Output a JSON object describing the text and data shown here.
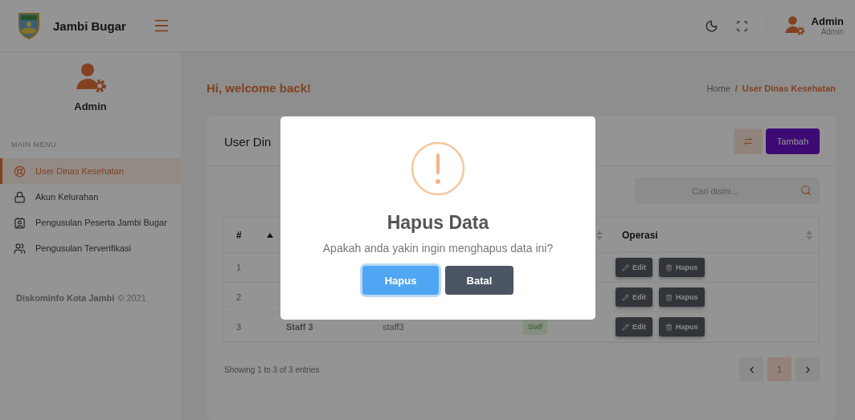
{
  "brand": {
    "name": "Jambi Bugar"
  },
  "topbar": {
    "user_name": "Admin",
    "user_role": "Admin"
  },
  "sidebar": {
    "profile_name": "Admin",
    "section_label": "MAIN MENU",
    "items": [
      {
        "label": "User Dinas Kesehatan",
        "kind": "lifebuoy",
        "selected": true
      },
      {
        "label": "Akun Kelurahan",
        "kind": "lock",
        "selected": false
      },
      {
        "label": "Pengusulan Peserta Jambi Bugar",
        "kind": "idcard",
        "selected": false
      },
      {
        "label": "Pengusulan Terverifikasi",
        "kind": "users",
        "selected": false
      }
    ],
    "footer_brand": "Diskominfo Kota Jambi",
    "footer_year": "© 2021"
  },
  "page": {
    "greeting": "Hi, welcome back!",
    "breadcrumb": [
      {
        "label": "Home",
        "selected": false
      },
      {
        "label": "User Dinas Kesehatan",
        "selected": true
      }
    ],
    "breadcrumb_separator": "/"
  },
  "card": {
    "title": "User Din",
    "add_button": "Tambah",
    "search": {
      "placeholder": "Cari disini..."
    },
    "columns": [
      {
        "label": "#",
        "sortable": true,
        "sorted": true
      },
      {},
      {},
      {
        "sortable": true,
        "sorted": false
      },
      {
        "label": "Operasi",
        "sortable": true,
        "sorted": false
      }
    ],
    "rows": [
      {
        "number": "1",
        "actions": [
          {
            "kind": "edit",
            "label": "Edit"
          },
          {
            "kind": "delete",
            "label": "Hapus"
          }
        ]
      },
      {
        "number": "2",
        "actions": [
          {
            "kind": "edit",
            "label": "Edit"
          },
          {
            "kind": "delete",
            "label": "Hapus"
          }
        ]
      },
      {
        "number": "3",
        "name": "Staff 3",
        "username": "staff3",
        "role": "Staff",
        "actions": [
          {
            "kind": "edit",
            "label": "Edit"
          },
          {
            "kind": "delete",
            "label": "Hapus"
          }
        ]
      }
    ],
    "info": "Showing 1 to 3 of 3 entries",
    "pages": [
      {
        "label": "1",
        "selected": true
      }
    ]
  },
  "dialog": {
    "title": "Hapus Data",
    "message": "Apakah anda yakin ingin menghapus data ini?",
    "confirm": "Hapus",
    "cancel": "Batal"
  }
}
